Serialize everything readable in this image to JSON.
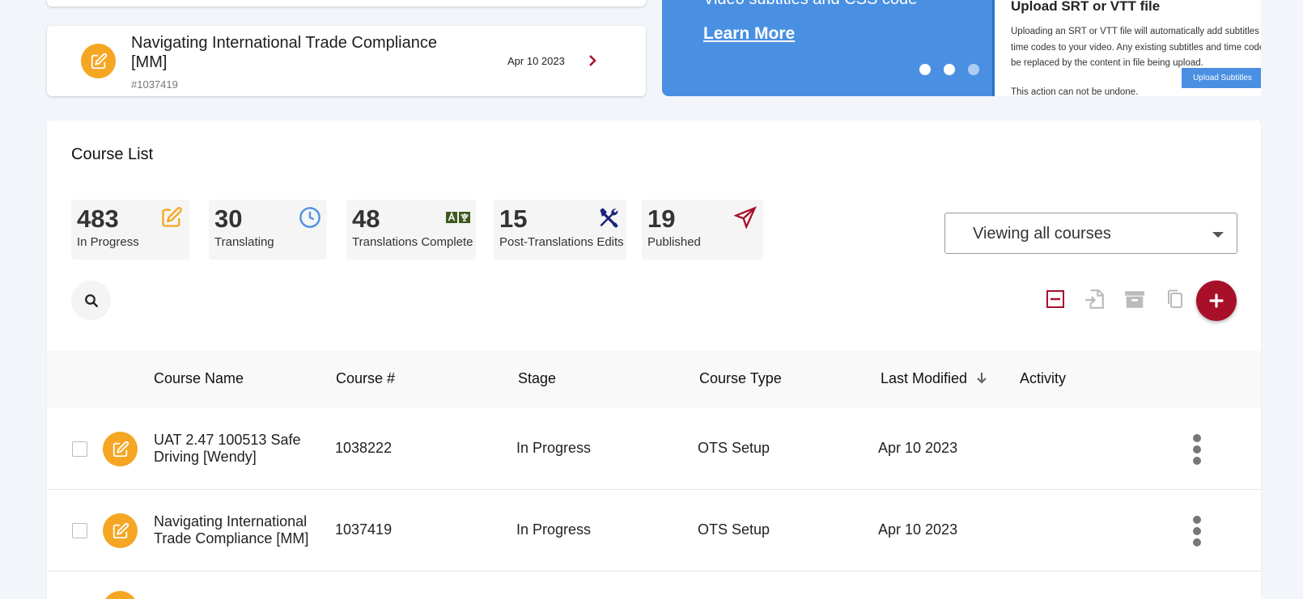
{
  "recent_card": {
    "title": "Navigating International Trade Compliance [MM]",
    "number": "#1037419",
    "date": "Apr 10 2023",
    "icon": "edit-icon"
  },
  "promo": {
    "heading": "Video subtitles and CSS code",
    "link": "Learn More",
    "dots": 3,
    "active_dot": 2
  },
  "upload": {
    "heading": "Upload SRT or VTT file",
    "body": "Uploading an SRT or VTT file will automatically add subtitles and time codes to your video. Any existing subtitles and time codes will be replaced by the content in file being upload.",
    "button": "Upload Subtitles",
    "warning": "This action can not be undone."
  },
  "course_list": {
    "title": "Course List",
    "stats": [
      {
        "value": "483",
        "label": "In Progress",
        "icon": "edit-icon",
        "color": "#f5a623"
      },
      {
        "value": "30",
        "label": "Translating",
        "icon": "clock-icon",
        "color": "#4a90e2"
      },
      {
        "value": "48",
        "label": "Translations Complete",
        "icon": "translate-icon",
        "color": "#3d5a1e"
      },
      {
        "value": "15",
        "label": "Post-Translations Edits",
        "icon": "tools-icon",
        "color": "#1a237e"
      },
      {
        "value": "19",
        "label": "Published",
        "icon": "paper-plane-icon",
        "color": "#a8102a"
      }
    ],
    "filter": {
      "selected": "Viewing all courses"
    },
    "toolbar": [
      "remove-icon",
      "import-icon",
      "archive-icon",
      "copy-icon",
      "add-icon"
    ],
    "columns": [
      "Course Name",
      "Course #",
      "Stage",
      "Course Type",
      "Last Modified",
      "Activity"
    ],
    "sort_column": "Last Modified",
    "rows": [
      {
        "name": "UAT 2.47 100513 Safe Driving [Wendy]",
        "number": "1038222",
        "stage": "In Progress",
        "type": "OTS Setup",
        "modified": "Apr 10 2023"
      },
      {
        "name": "Navigating International Trade Compliance [MM]",
        "number": "1037419",
        "stage": "In Progress",
        "type": "OTS Setup",
        "modified": "Apr 10 2023"
      }
    ]
  }
}
